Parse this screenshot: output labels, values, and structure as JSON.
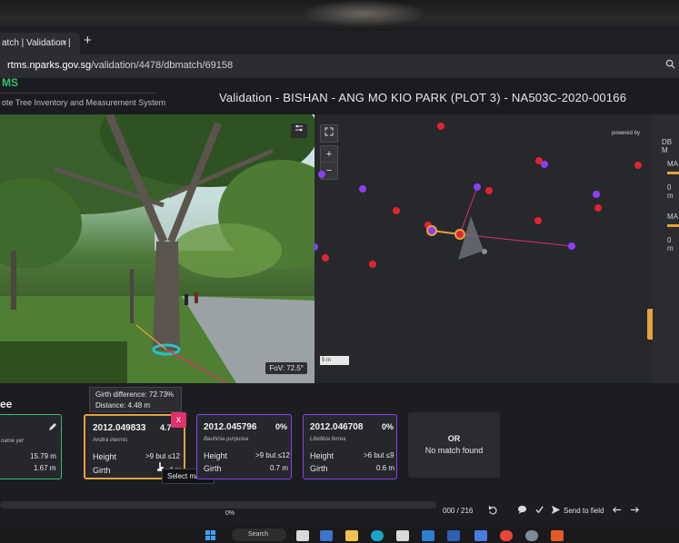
{
  "browser": {
    "tab_title": "atch | Validation |",
    "tab_close": "×",
    "new_tab": "+",
    "url_host": "rtms.nparks.gov.sg",
    "url_path": "/validation/4478/dbmatch/69158"
  },
  "app": {
    "logo": "MS",
    "logo_sub": "ote Tree Inventory and Measurement System",
    "title": "Validation - BISHAN - ANG MO KIO PARK (PLOT 3) - NA503C-2020-00166"
  },
  "streetview": {
    "fov": "FoV: 72.5°"
  },
  "map": {
    "zoom_in": "+",
    "zoom_out": "−",
    "powered": "powered by",
    "scale": "5 m",
    "right_panel": {
      "label": "DB M",
      "items": [
        "MA",
        "0 m",
        "MA",
        "0 m"
      ]
    }
  },
  "matches": {
    "section_title": "ee",
    "girth_difference": "Girth difference: 72.73%",
    "distance": "Distance: 4.48 m",
    "select_match": "Select match",
    "current": {
      "subtitle": "name yet",
      "height": "15.79 m",
      "girth": "1.67 m"
    },
    "labels": {
      "height": "Height",
      "girth": "Girth"
    },
    "cards": [
      {
        "id": "2012.049833",
        "pct": "4.7",
        "species": "Andira inermis",
        "height": ">9 but ≤12",
        "girth": "4 m"
      },
      {
        "id": "2012.045796",
        "pct": "0%",
        "species": "Bauhinia purpurea",
        "height": ">9 but ≤12",
        "girth": "0.7 m"
      },
      {
        "id": "2012.046708",
        "pct": "0%",
        "species": "Libidibia ferrea",
        "height": ">6 but ≤9",
        "girth": "0.6 m"
      }
    ],
    "or": "OR",
    "no_match": "No match found"
  },
  "footer": {
    "progress": "0%",
    "count": "000 / 216",
    "send_to_field": "Send to field"
  },
  "taskbar": {
    "search": "Search"
  },
  "colors": {
    "accent": "#e5a23a",
    "brand": "#2fbf71",
    "purple": "#8a3ff5",
    "red": "#e0242f",
    "pink": "#e1306c"
  }
}
